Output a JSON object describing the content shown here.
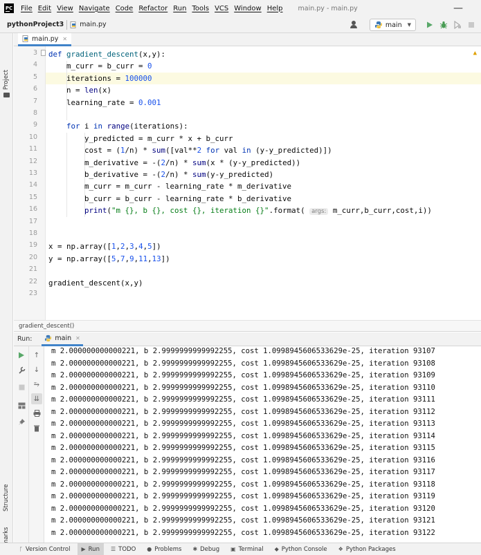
{
  "menubar": {
    "logo_text": "PC",
    "items": [
      "File",
      "Edit",
      "View",
      "Navigate",
      "Code",
      "Refactor",
      "Run",
      "Tools",
      "VCS",
      "Window",
      "Help"
    ],
    "window_title": "main.py - main.py",
    "minimize": "—"
  },
  "navbar": {
    "project": "pythonProject3",
    "file": "main.py",
    "run_config": "main"
  },
  "editor": {
    "tab_label": "main.py",
    "line_numbers": [
      "3",
      "4",
      "5",
      "6",
      "7",
      "8",
      "9",
      "10",
      "11",
      "12",
      "13",
      "14",
      "15",
      "16",
      "17",
      "18",
      "19",
      "20",
      "21",
      "22",
      "23"
    ],
    "highlighted_line": 3,
    "inlay_hint": "args:",
    "breadcrumb": "gradient_descent()"
  },
  "tool_strip": {
    "project": "Project",
    "structure": "Structure",
    "bookmarks": "Bookmarks"
  },
  "run_panel": {
    "label": "Run:",
    "tab_label": "main",
    "console_lines": [
      "m 2.000000000000221, b 2.9999999999992255, cost 1.0998945606533629e-25, iteration 93107",
      "m 2.000000000000221, b 2.9999999999992255, cost 1.0998945606533629e-25, iteration 93108",
      "m 2.000000000000221, b 2.9999999999992255, cost 1.0998945606533629e-25, iteration 93109",
      "m 2.000000000000221, b 2.9999999999992255, cost 1.0998945606533629e-25, iteration 93110",
      "m 2.000000000000221, b 2.9999999999992255, cost 1.0998945606533629e-25, iteration 93111",
      "m 2.000000000000221, b 2.9999999999992255, cost 1.0998945606533629e-25, iteration 93112",
      "m 2.000000000000221, b 2.9999999999992255, cost 1.0998945606533629e-25, iteration 93113",
      "m 2.000000000000221, b 2.9999999999992255, cost 1.0998945606533629e-25, iteration 93114",
      "m 2.000000000000221, b 2.9999999999992255, cost 1.0998945606533629e-25, iteration 93115",
      "m 2.000000000000221, b 2.9999999999992255, cost 1.0998945606533629e-25, iteration 93116",
      "m 2.000000000000221, b 2.9999999999992255, cost 1.0998945606533629e-25, iteration 93117",
      "m 2.000000000000221, b 2.9999999999992255, cost 1.0998945606533629e-25, iteration 93118",
      "m 2.000000000000221, b 2.9999999999992255, cost 1.0998945606533629e-25, iteration 93119",
      "m 2.000000000000221, b 2.9999999999992255, cost 1.0998945606533629e-25, iteration 93120",
      "m 2.000000000000221, b 2.9999999999992255, cost 1.0998945606533629e-25, iteration 93121",
      "m 2.000000000000221, b 2.9999999999992255, cost 1.0998945606533629e-25, iteration 93122"
    ]
  },
  "bottom_bar": {
    "items": [
      "Version Control",
      "Run",
      "TODO",
      "Problems",
      "Debug",
      "Terminal",
      "Python Console",
      "Python Packages"
    ]
  },
  "colors": {
    "accent": "#4083c9",
    "keyword": "#0033b3",
    "number": "#1750eb",
    "string": "#067d17",
    "run_green": "#59a869",
    "debug_green": "#499c54"
  },
  "icons": {
    "run": "run-icon",
    "debug": "debug-icon",
    "python_file": "python-file-icon",
    "user": "user-icon",
    "warning": "warning-icon"
  }
}
